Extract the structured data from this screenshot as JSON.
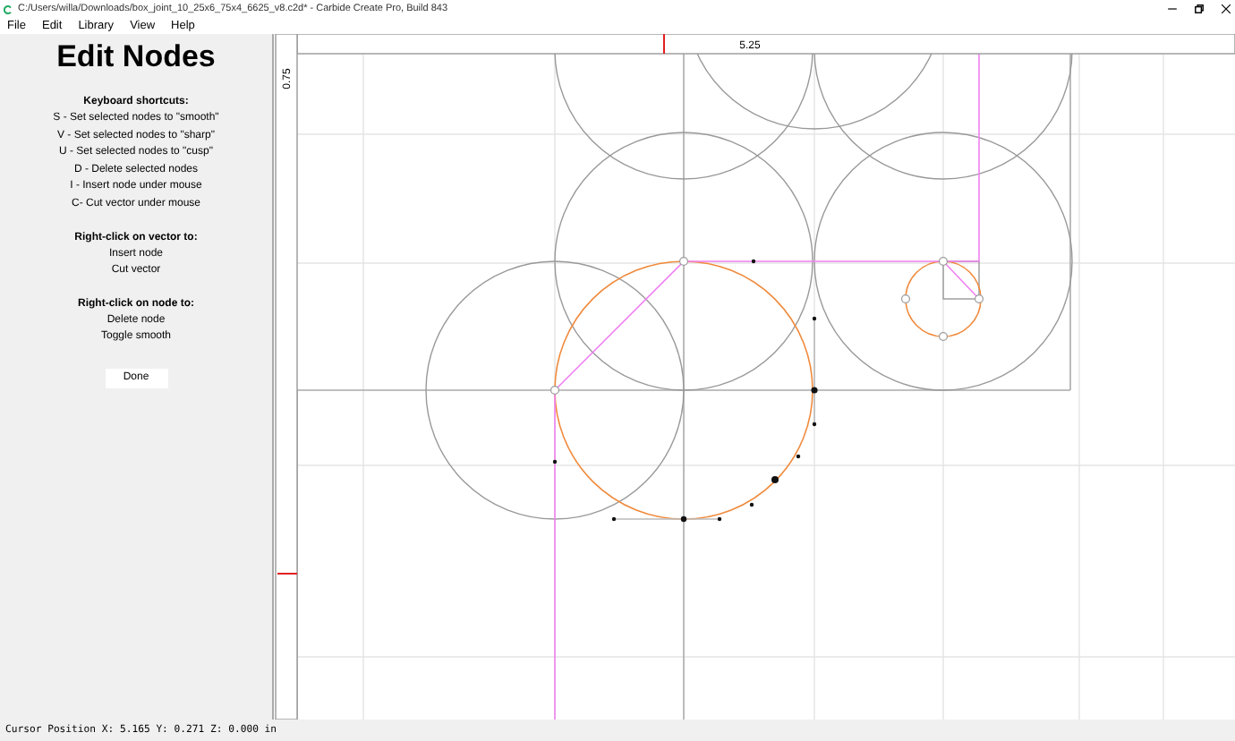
{
  "window": {
    "title": "C:/Users/willa/Downloads/box_joint_10_25x6_75x4_6625_v8.c2d* - Carbide Create Pro, Build 843"
  },
  "menu": [
    "File",
    "Edit",
    "Library",
    "View",
    "Help"
  ],
  "panel": {
    "title": "Edit Nodes",
    "sections": [
      {
        "heading": "Keyboard shortcuts:",
        "items": [
          "S - Set selected nodes to \"smooth\"",
          "V - Set selected nodes to \"sharp\"",
          "U - Set selected nodes to \"cusp\"",
          "D - Delete selected nodes",
          "I - Insert node under mouse",
          "C- Cut vector under mouse"
        ]
      },
      {
        "heading": "Right-click on vector to:",
        "items": [
          "Insert node",
          "Cut vector"
        ]
      },
      {
        "heading": "Right-click on node to:",
        "items": [
          "Delete node",
          "Toggle smooth"
        ]
      }
    ],
    "button": "Done"
  },
  "rulers": {
    "x_label": "5.25",
    "y_label": "0.75"
  },
  "status_bar": "Cursor Position X: 5.165 Y: 0.271 Z: 0.000 in"
}
